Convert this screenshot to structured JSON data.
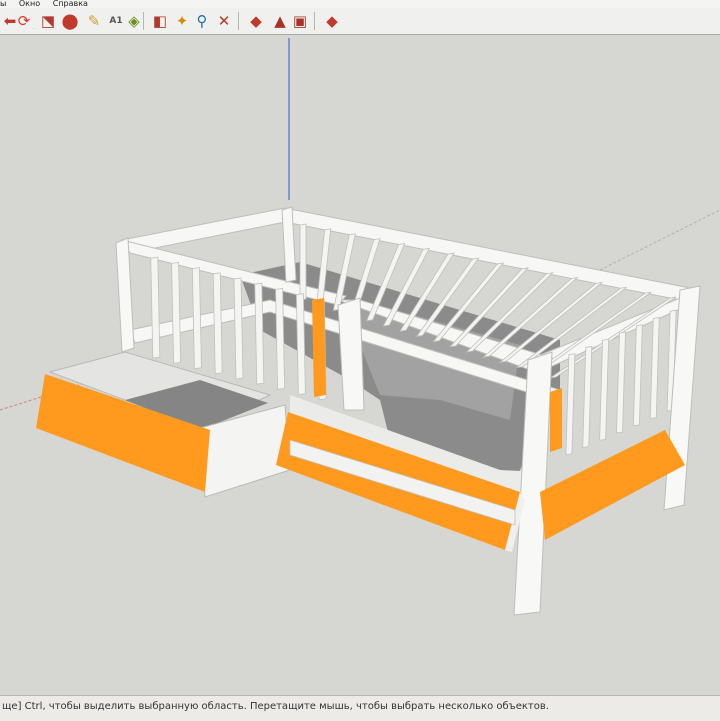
{
  "menu": {
    "items": [
      "ы",
      "Окно",
      "Справка"
    ]
  },
  "toolbar": {
    "buttons": [
      {
        "name": "arrow-back-icon",
        "glyph": "⬅",
        "color": "#c0392b"
      },
      {
        "name": "orbit-icon",
        "glyph": "⟳",
        "color": "#d43a2a"
      },
      {
        "name": "scale-tool-icon",
        "glyph": "⬔",
        "color": "#b03a2e"
      },
      {
        "name": "paint-bucket-icon",
        "glyph": "⬤",
        "color": "#c0392b"
      },
      {
        "name": "tape-measure-icon",
        "glyph": "✎",
        "color": "#c9a227"
      },
      {
        "name": "text-label-icon",
        "glyph": "A1",
        "color": "#555555"
      },
      {
        "name": "materials-icon",
        "glyph": "◈",
        "color": "#6b8e23"
      },
      {
        "name": "section-plane-icon",
        "glyph": "◧",
        "color": "#b03a2e"
      },
      {
        "name": "walk-tool-icon",
        "glyph": "✦",
        "color": "#d68910"
      },
      {
        "name": "zoom-icon",
        "glyph": "⚲",
        "color": "#2471a3"
      },
      {
        "name": "zoom-extents-icon",
        "glyph": "✕",
        "color": "#b03a2e"
      },
      {
        "name": "ruby-gem-icon",
        "glyph": "◆",
        "color": "#c0392b"
      },
      {
        "name": "warehouse-icon",
        "glyph": "▲",
        "color": "#a93226"
      },
      {
        "name": "extension-icon",
        "glyph": "▣",
        "color": "#a93226"
      },
      {
        "name": "share-model-icon",
        "glyph": "◆",
        "color": "#c0392b"
      }
    ]
  },
  "status": {
    "text": "ще] Ctrl, чтобы выделить выбранную область. Перетащите мышь, чтобы выбрать несколько объектов."
  },
  "colors": {
    "drawer_front": "#ff9a1f",
    "frame": "#f4f4f2",
    "mattress": "#8e8e8e",
    "viewport_bg": "#d6d6d2",
    "blue_axis": "#4a6fd0"
  }
}
